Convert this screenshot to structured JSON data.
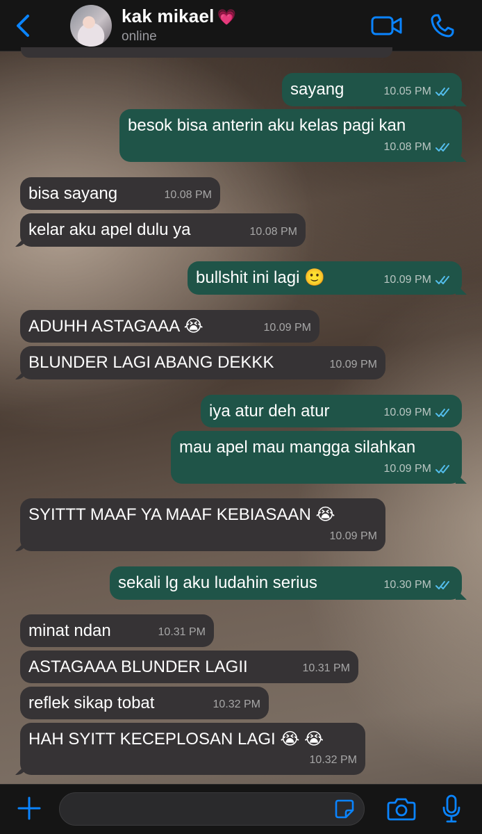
{
  "header": {
    "contact_name": "kak mikael",
    "name_emoji": "💗",
    "status": "online",
    "accent_color": "#0a84ff"
  },
  "messages": [
    {
      "dir": "out",
      "text": "sayang",
      "time": "10.05 PM",
      "read": true
    },
    {
      "dir": "out",
      "text": "besok bisa anterin aku kelas pagi kan",
      "time": "10.08 PM",
      "read": true
    },
    {
      "dir": "in",
      "text": "bisa sayang",
      "time": "10.08 PM"
    },
    {
      "dir": "in",
      "text": "kelar aku apel dulu ya",
      "time": "10.08 PM"
    },
    {
      "dir": "out",
      "text": "bullshit ini lagi 🙂",
      "time": "10.09 PM",
      "read": true
    },
    {
      "dir": "in",
      "text": "ADUHH ASTAGAAA 😭",
      "time": "10.09 PM"
    },
    {
      "dir": "in",
      "text": "BLUNDER LAGI ABANG DEKKK",
      "time": "10.09 PM"
    },
    {
      "dir": "out",
      "text": "iya atur deh atur",
      "time": "10.09 PM",
      "read": true
    },
    {
      "dir": "out",
      "text": "mau apel mau mangga silahkan",
      "time": "10.09 PM",
      "read": true
    },
    {
      "dir": "in",
      "text": "SYITTT MAAF YA MAAF KEBIASAAN 😭",
      "time": "10.09 PM"
    },
    {
      "dir": "out",
      "text": "sekali lg aku ludahin serius",
      "time": "10.30 PM",
      "read": true
    },
    {
      "dir": "in",
      "text": "minat ndan",
      "time": "10.31 PM"
    },
    {
      "dir": "in",
      "text": "ASTAGAAA BLUNDER LAGII",
      "time": "10.31 PM"
    },
    {
      "dir": "in",
      "text": "reflek sikap tobat",
      "time": "10.32 PM"
    },
    {
      "dir": "in",
      "text": "HAH SYITT KECEPLOSAN LAGI 😭 😭",
      "time": "10.32 PM"
    }
  ],
  "composer": {
    "value": ""
  },
  "icons": {
    "back": "chevron-left-icon",
    "video": "video-camera-icon",
    "phone": "phone-icon",
    "plus": "plus-icon",
    "sticker": "sticker-icon",
    "camera": "camera-icon",
    "mic": "microphone-icon"
  },
  "colors": {
    "incoming_bubble": "#363335",
    "outgoing_bubble": "#1f5448",
    "read_ticks": "#53bdeb"
  }
}
